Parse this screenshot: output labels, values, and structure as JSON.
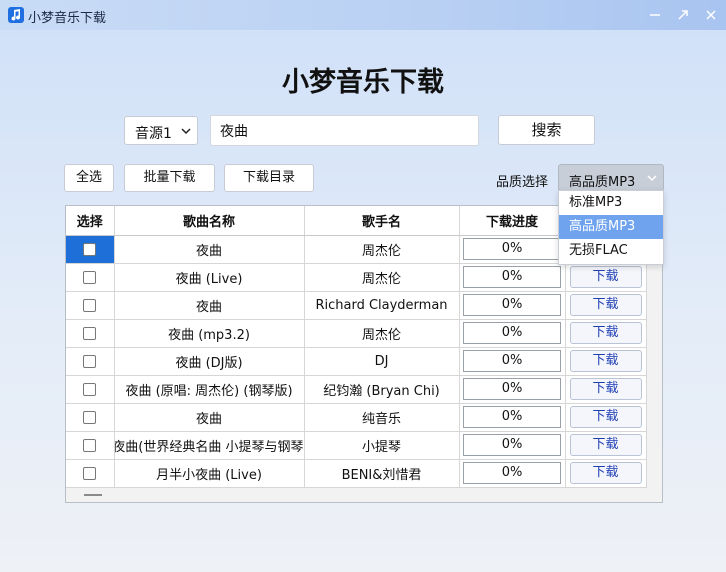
{
  "window": {
    "title": "小梦音乐下载"
  },
  "header": {
    "title": "小梦音乐下载"
  },
  "search": {
    "source": "音源1",
    "query": "夜曲",
    "button": "搜索"
  },
  "toolbar": {
    "select_all": "全选",
    "batch_download": "批量下载",
    "download_dir": "下载目录",
    "quality_label": "品质选择",
    "quality_value": "高品质MP3"
  },
  "quality_options": [
    "标准MP3",
    "高品质MP3",
    "无损FLAC"
  ],
  "table": {
    "headers": [
      "选择",
      "歌曲名称",
      "歌手名",
      "下载进度",
      ""
    ],
    "rows": [
      {
        "song": "夜曲",
        "artist": "周杰伦",
        "progress": "0%",
        "action": "下载"
      },
      {
        "song": "夜曲 (Live)",
        "artist": "周杰伦",
        "progress": "0%",
        "action": "下载"
      },
      {
        "song": "夜曲",
        "artist": "Richard Clayderman",
        "progress": "0%",
        "action": "下载"
      },
      {
        "song": "夜曲 (mp3.2)",
        "artist": "周杰伦",
        "progress": "0%",
        "action": "下载"
      },
      {
        "song": "夜曲 (DJ版)",
        "artist": "DJ",
        "progress": "0%",
        "action": "下载"
      },
      {
        "song": "夜曲 (原唱: 周杰伦) (钢琴版)",
        "artist": "纪钧瀚 (Bryan Chi)",
        "progress": "0%",
        "action": "下载"
      },
      {
        "song": "夜曲",
        "artist": "纯音乐",
        "progress": "0%",
        "action": "下载"
      },
      {
        "song": "夜曲(世界经典名曲 小提琴与钢琴",
        "artist": "小提琴",
        "progress": "0%",
        "action": "下载"
      },
      {
        "song": "月半小夜曲 (Live)",
        "artist": "BENI&刘惜君",
        "progress": "0%",
        "action": "下载"
      }
    ]
  },
  "colors": {
    "accent": "#1f6fd8",
    "dropdown_active": "#6fa3ee",
    "link": "#1f3fb5"
  }
}
